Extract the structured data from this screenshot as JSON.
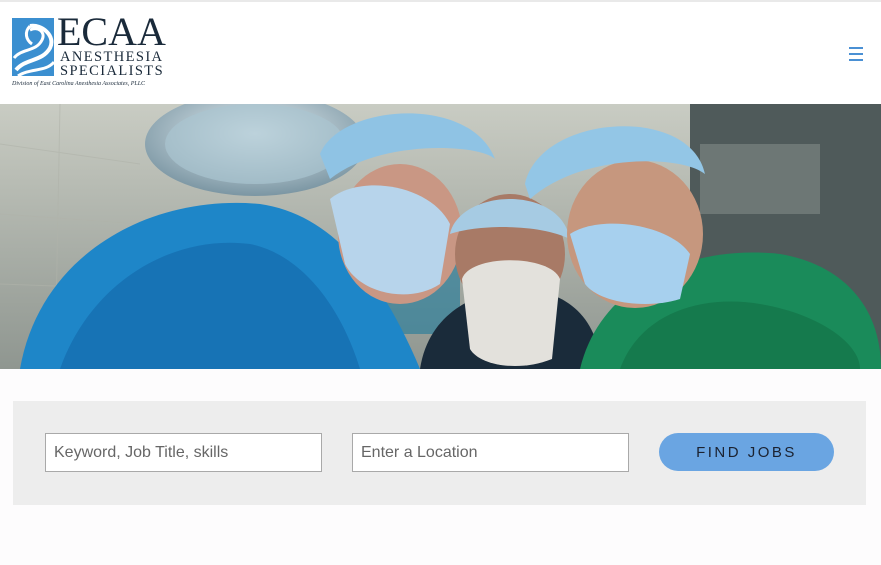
{
  "logo": {
    "line1": "ECAA",
    "line2": "ANESTHESIA",
    "line3": "SPECIALISTS",
    "subtitle": "Division of East Carolina Anesthesia Associates, PLLC",
    "brand_blue": "#3b8fd0"
  },
  "nav": {
    "menu_icon": "hamburger-menu-icon",
    "accent": "#4a90d4"
  },
  "hero": {
    "image_alt": "surgeons-in-scrubs-operating-photo"
  },
  "search": {
    "keyword_placeholder": "Keyword, Job Title, skills",
    "location_placeholder": "Enter a Location",
    "button_label": "FIND JOBS",
    "button_color": "#6aa5e2"
  }
}
